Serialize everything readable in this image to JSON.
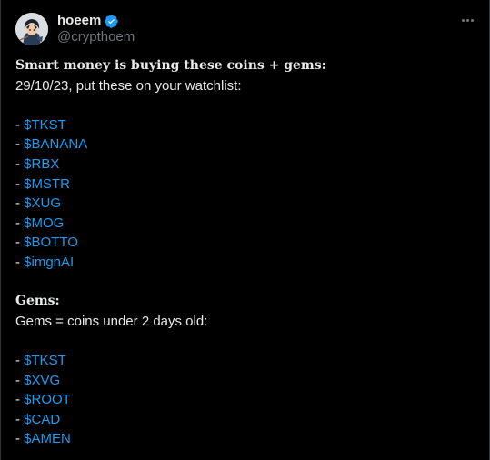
{
  "author": {
    "display_name": "hoeem",
    "handle": "@crypthoem",
    "verified": true,
    "avatar_icon": "avatar-character-icon"
  },
  "menu": {
    "more_icon": "more-horizontal-icon"
  },
  "colors": {
    "background": "#000000",
    "text": "#e7e9ea",
    "secondary_text": "#71767b",
    "link": "#1d9bf0",
    "verified_badge": "#1d9bf0"
  },
  "tweet": {
    "heading": "Smart money is buying these coins + gems:",
    "subheading": "29/10/23, put these on your watchlist:",
    "dash": "- ",
    "watchlist": [
      "$TKST",
      "$BANANA",
      "$RBX",
      "$MSTR",
      "$XUG",
      "$MOG",
      "$BOTTO",
      "$imgnAI"
    ],
    "gems_heading": "Gems:",
    "gems_subheading": "Gems = coins under 2 days old:",
    "gems": [
      "$TKST",
      "$XVG",
      "$ROOT",
      "$CAD",
      "$AMEN"
    ]
  }
}
